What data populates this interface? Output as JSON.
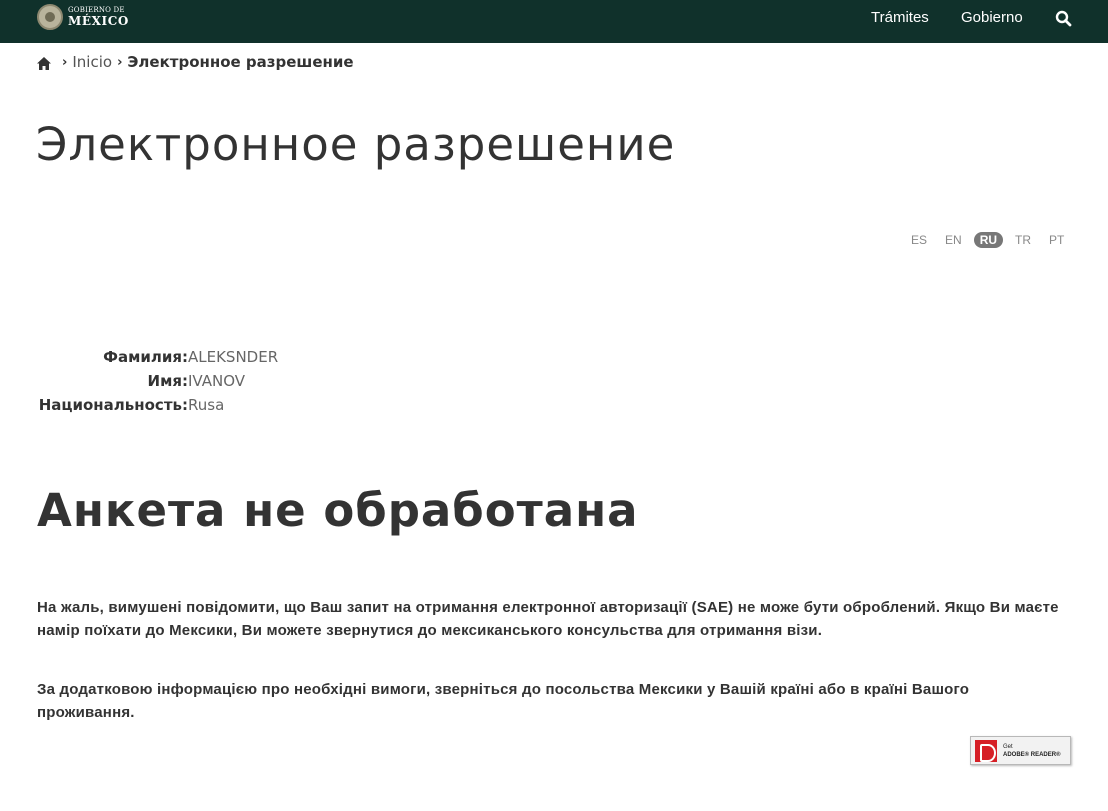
{
  "navbar": {
    "logo_small": "GOBIERNO DE",
    "logo_big": "MÉXICO",
    "links": [
      "Trámites",
      "Gobierno"
    ],
    "search_icon": "search-icon",
    "background": "#10312b"
  },
  "breadcrumb": {
    "home_icon": "home-icon",
    "items": [
      "Inicio",
      "Электронное разрешение"
    ]
  },
  "page": {
    "title": "Электронное разрешение"
  },
  "languages": {
    "items": [
      "ES",
      "EN",
      "RU",
      "TR",
      "PT"
    ],
    "active": "RU"
  },
  "applicant": {
    "surname_label": "Фамилия:",
    "surname_value": "ALEKSNDER",
    "name_label": "Имя:",
    "name_value": "IVANOV",
    "nationality_label": "Национальность:",
    "nationality_value": "Rusa"
  },
  "status": {
    "title": "Анкета не обработана",
    "paragraph1": "На жаль, вимушені повідомити, що Ваш запит на отримання електронної авторизації (SAE) не може бути оброблений. Якщо Ви маєте намір поїхати до Мексики, Ви можете звернутися до мексиканського консульства для отримання візи.",
    "paragraph2": "За додатковою інформацією про необхідні вимоги, зверніться до посольства Мексики у Вашій країні або в країні Вашого проживання."
  },
  "adobe_badge": {
    "line1": "Get",
    "line2": "ADOBE® READER®",
    "icon": "adobe-reader-icon",
    "color": "#d61f26"
  }
}
